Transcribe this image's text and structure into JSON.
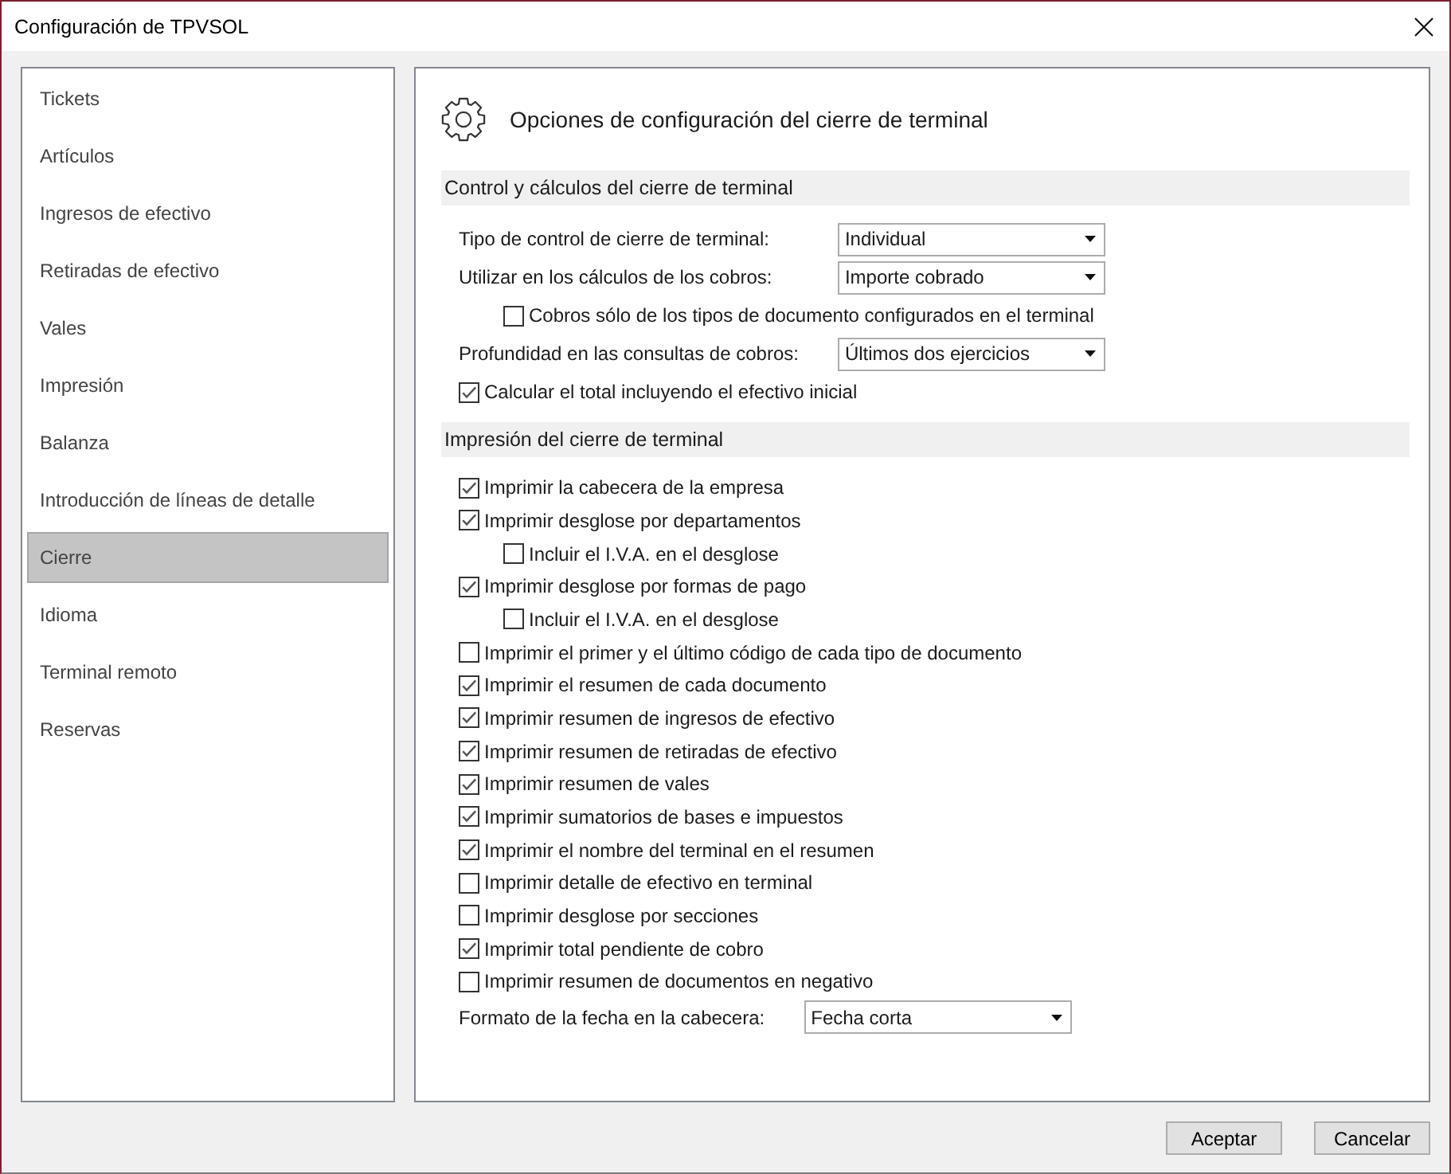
{
  "window": {
    "title": "Configuración de TPVSOL"
  },
  "sidebar": {
    "items": [
      {
        "label": "Tickets",
        "selected": false
      },
      {
        "label": "Artículos",
        "selected": false
      },
      {
        "label": "Ingresos de efectivo",
        "selected": false
      },
      {
        "label": "Retiradas de efectivo",
        "selected": false
      },
      {
        "label": "Vales",
        "selected": false
      },
      {
        "label": "Impresión",
        "selected": false
      },
      {
        "label": "Balanza",
        "selected": false
      },
      {
        "label": "Introducción de líneas de detalle",
        "selected": false
      },
      {
        "label": "Cierre",
        "selected": true
      },
      {
        "label": "Idioma",
        "selected": false
      },
      {
        "label": "Terminal remoto",
        "selected": false
      },
      {
        "label": "Reservas",
        "selected": false
      }
    ]
  },
  "panel": {
    "title": "Opciones de configuración del cierre de terminal",
    "sections": [
      {
        "title": "Control y cálculos del cierre de terminal",
        "rows": [
          {
            "kind": "select",
            "label": "Tipo de control de cierre de terminal:",
            "value": "Individual"
          },
          {
            "kind": "select",
            "label": "Utilizar en los cálculos de los cobros:",
            "value": "Importe cobrado",
            "children": [
              {
                "kind": "checkbox",
                "label": "Cobros sólo de los tipos de documento configurados en el terminal",
                "checked": false
              }
            ]
          },
          {
            "kind": "select",
            "label": "Profundidad en las consultas de cobros:",
            "value": "Últimos dos ejercicios"
          },
          {
            "kind": "checkbox",
            "label": "Calcular el total incluyendo el efectivo inicial",
            "checked": true
          }
        ]
      },
      {
        "title": "Impresión del cierre de terminal",
        "rows": [
          {
            "kind": "checkbox",
            "label": "Imprimir la cabecera de la empresa",
            "checked": true
          },
          {
            "kind": "checkbox",
            "label": "Imprimir desglose por departamentos",
            "checked": true,
            "children": [
              {
                "kind": "checkbox",
                "label": "Incluir el I.V.A. en el desglose",
                "checked": false
              }
            ]
          },
          {
            "kind": "checkbox",
            "label": "Imprimir desglose por formas de pago",
            "checked": true,
            "children": [
              {
                "kind": "checkbox",
                "label": "Incluir el I.V.A. en el desglose",
                "checked": false
              }
            ]
          },
          {
            "kind": "checkbox",
            "label": "Imprimir el primer y el último código de cada tipo de documento",
            "checked": false
          },
          {
            "kind": "checkbox",
            "label": "Imprimir el resumen de cada documento",
            "checked": true
          },
          {
            "kind": "checkbox",
            "label": "Imprimir resumen de ingresos de efectivo",
            "checked": true
          },
          {
            "kind": "checkbox",
            "label": "Imprimir resumen de retiradas de efectivo",
            "checked": true
          },
          {
            "kind": "checkbox",
            "label": "Imprimir resumen de vales",
            "checked": true
          },
          {
            "kind": "checkbox",
            "label": "Imprimir sumatorios de bases e impuestos",
            "checked": true
          },
          {
            "kind": "checkbox",
            "label": "Imprimir el nombre del terminal en el resumen",
            "checked": true
          },
          {
            "kind": "checkbox",
            "label": "Imprimir detalle de efectivo en terminal",
            "checked": false
          },
          {
            "kind": "checkbox",
            "label": "Imprimir desglose por secciones",
            "checked": false
          },
          {
            "kind": "checkbox",
            "label": "Imprimir total pendiente de cobro",
            "checked": true
          },
          {
            "kind": "checkbox",
            "label": "Imprimir resumen de documentos en negativo",
            "checked": false
          },
          {
            "kind": "select",
            "label": "Formato de la fecha en la cabecera:",
            "value": "Fecha corta"
          }
        ]
      }
    ]
  },
  "buttons": [
    "Aceptar",
    "Cancelar"
  ]
}
